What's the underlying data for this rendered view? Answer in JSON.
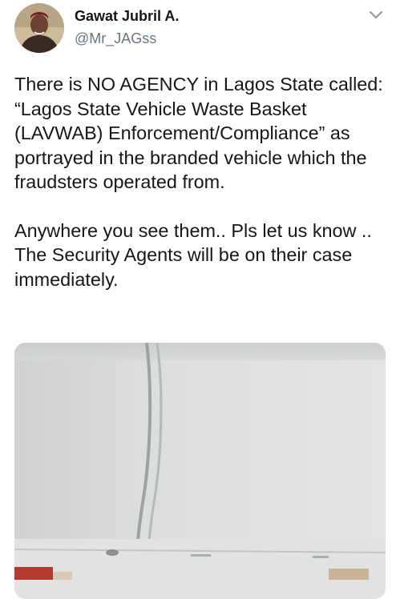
{
  "tweet": {
    "author": {
      "display_name": "Gawat Jubril A.",
      "handle": "@Mr_JAGss"
    },
    "menu_icon": "chevron-down-icon",
    "text_paragraphs": [
      "There is NO AGENCY in Lagos State called: “Lagos State Vehicle Waste Basket (LAVWAB) Enforcement/Compliance” as portrayed in the branded vehicle which the fraudsters operated from.",
      "Anywhere you see them.. Pls let us know .. The Security Agents will be on their case immediately."
    ],
    "media": {
      "type": "photo",
      "description_visible": "close-up of white vehicle body panel"
    }
  },
  "colors": {
    "text_primary": "#14171a",
    "text_secondary": "#657786",
    "background": "#ffffff"
  }
}
